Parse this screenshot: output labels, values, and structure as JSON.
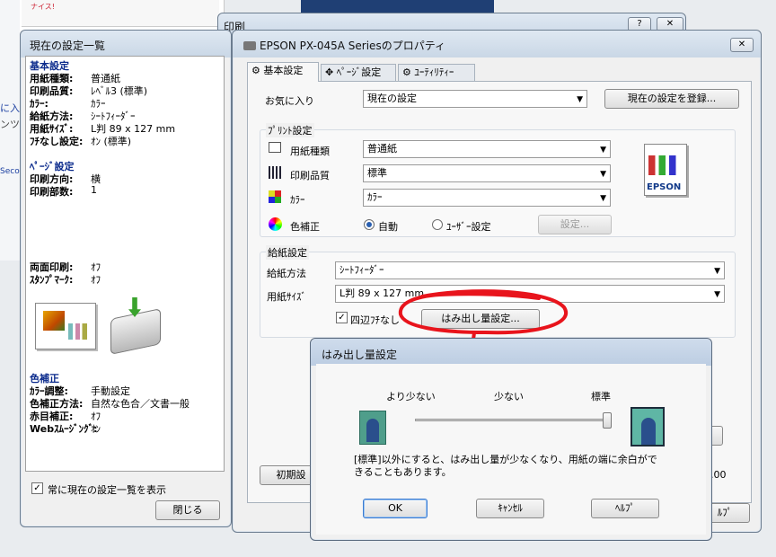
{
  "background": {
    "frag1": "ナイス!",
    "frag2": "に入",
    "frag3": "ンツ",
    "frag4": "Seco"
  },
  "print_dialog": {
    "title": "印刷",
    "help_btn": "?",
    "close_btn": "✕"
  },
  "current_settings": {
    "title": "現在の設定一覧",
    "sections": [
      {
        "heading": "基本設定",
        "items": [
          {
            "label": "用紙種類:",
            "value": "普通紙"
          },
          {
            "label": "印刷品質:",
            "value": "ﾚﾍﾞﾙ3 (標準)"
          },
          {
            "label": "ｶﾗｰ:",
            "value": "ｶﾗｰ"
          },
          {
            "label": "給紙方法:",
            "value": "ｼｰﾄﾌｨｰﾀﾞｰ"
          },
          {
            "label": "用紙ｻｲｽﾞ:",
            "value": "L判 89 x 127 mm"
          },
          {
            "label": "ﾌﾁなし設定:",
            "value": "ｵﾝ (標準)"
          }
        ]
      },
      {
        "heading": "ﾍﾟｰｼﾞ設定",
        "items": [
          {
            "label": "印刷方向:",
            "value": "横"
          },
          {
            "label": "印刷部数:",
            "value": "1"
          }
        ]
      }
    ],
    "extra_items": [
      {
        "label": "両面印刷:",
        "value": "ｵﾌ"
      },
      {
        "label": "ｽﾀﾝﾌﾟﾏｰｸ:",
        "value": "ｵﾌ"
      }
    ],
    "color_heading": "色補正",
    "color_items": [
      {
        "label": "ｶﾗｰ調整:",
        "value": "手動設定"
      },
      {
        "label": "色補正方法:",
        "value": "自然な色合／文書一般"
      },
      {
        "label": "赤目補正:",
        "value": "ｵﾌ"
      },
      {
        "label": "Webｽﾑｰｼﾞﾝｸﾞ:",
        "value": "ｵﾝ"
      }
    ],
    "always_show_checkbox": "常に現在の設定一覧を表示",
    "close_button": "閉じる"
  },
  "properties": {
    "title": "EPSON PX-045A Seriesのプロパティ",
    "close_btn": "✕",
    "tabs": [
      "基本設定",
      "ﾍﾟｰｼﾞ設定",
      "ﾕｰﾃｨﾘﾃｨｰ"
    ],
    "favorites_label": "お気に入り",
    "favorites_value": "現在の設定",
    "register_button": "現在の設定を登録...",
    "print_group": "ﾌﾟﾘﾝﾄ設定",
    "paper_type_label": "用紙種類",
    "paper_type_value": "普通紙",
    "quality_label": "印刷品質",
    "quality_value": "標準",
    "color_label": "ｶﾗｰ",
    "color_value": "ｶﾗｰ",
    "color_correction_label": "色補正",
    "radio_auto": "自動",
    "radio_user": "ﾕｰｻﾞｰ設定",
    "settings_button": "設定...",
    "feed_group": "給紙設定",
    "feed_method_label": "給紙方法",
    "feed_method_value": "ｼｰﾄﾌｨｰﾀﾞｰ",
    "paper_size_label": "用紙ｻｲｽﾞ",
    "paper_size_value": "L判 89 x 127 mm",
    "borderless_label": "四辺ﾌﾁなし",
    "overflow_button": "はみ出し量設定...",
    "reset_button": "初期設",
    "version_frag": ".00",
    "help_frag": "ﾙﾌﾟ",
    "epson_logo": "EPSON"
  },
  "overflow_dialog": {
    "title": "はみ出し量設定",
    "less_label": "より少ない",
    "few_label": "少ない",
    "standard_label": "標準",
    "slider_value_percent": 100,
    "note": "[標準]以外にすると、はみ出し量が少なくなり、用紙の端に余白がで\nきることもあります。",
    "ok_button": "OK",
    "cancel_button": "ｷｬﾝｾﾙ",
    "help_button": "ﾍﾙﾌﾟ"
  },
  "colors": {
    "annotation": "#e8141c",
    "heading": "#0a2a8c"
  }
}
